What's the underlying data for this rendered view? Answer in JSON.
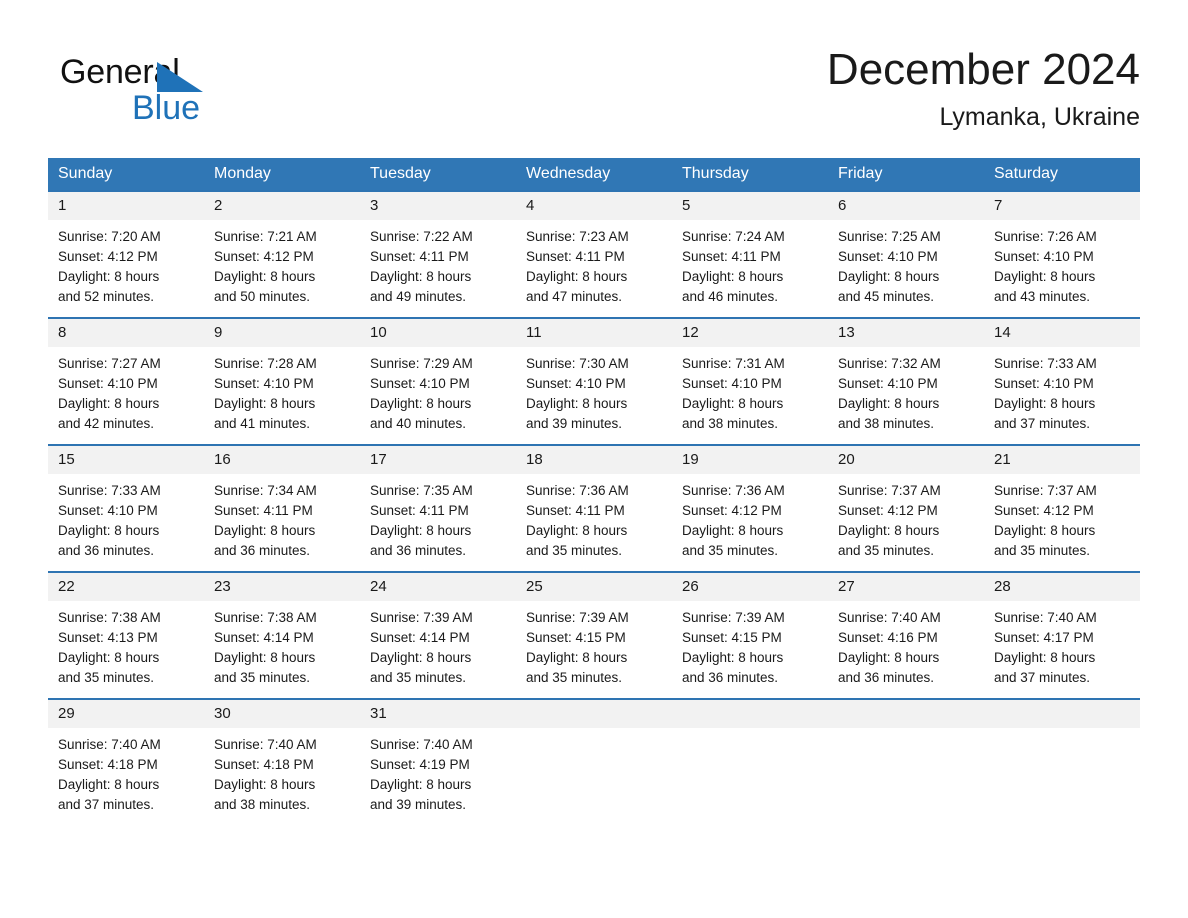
{
  "brand": {
    "line1": "General",
    "line2": "Blue",
    "accent_color": "#1f72b8",
    "triangle_icon": "brand-triangle-icon"
  },
  "header": {
    "month_title": "December 2024",
    "location": "Lymanka, Ukraine"
  },
  "calendar": {
    "header_bg": "#3077b5",
    "row_divider_color": "#2e74b2",
    "daynum_bg": "#f2f2f2",
    "weekdays": [
      "Sunday",
      "Monday",
      "Tuesday",
      "Wednesday",
      "Thursday",
      "Friday",
      "Saturday"
    ],
    "weeks": [
      [
        {
          "day": "1",
          "sunrise": "Sunrise: 7:20 AM",
          "sunset": "Sunset: 4:12 PM",
          "daylight_1": "Daylight: 8 hours",
          "daylight_2": "and 52 minutes."
        },
        {
          "day": "2",
          "sunrise": "Sunrise: 7:21 AM",
          "sunset": "Sunset: 4:12 PM",
          "daylight_1": "Daylight: 8 hours",
          "daylight_2": "and 50 minutes."
        },
        {
          "day": "3",
          "sunrise": "Sunrise: 7:22 AM",
          "sunset": "Sunset: 4:11 PM",
          "daylight_1": "Daylight: 8 hours",
          "daylight_2": "and 49 minutes."
        },
        {
          "day": "4",
          "sunrise": "Sunrise: 7:23 AM",
          "sunset": "Sunset: 4:11 PM",
          "daylight_1": "Daylight: 8 hours",
          "daylight_2": "and 47 minutes."
        },
        {
          "day": "5",
          "sunrise": "Sunrise: 7:24 AM",
          "sunset": "Sunset: 4:11 PM",
          "daylight_1": "Daylight: 8 hours",
          "daylight_2": "and 46 minutes."
        },
        {
          "day": "6",
          "sunrise": "Sunrise: 7:25 AM",
          "sunset": "Sunset: 4:10 PM",
          "daylight_1": "Daylight: 8 hours",
          "daylight_2": "and 45 minutes."
        },
        {
          "day": "7",
          "sunrise": "Sunrise: 7:26 AM",
          "sunset": "Sunset: 4:10 PM",
          "daylight_1": "Daylight: 8 hours",
          "daylight_2": "and 43 minutes."
        }
      ],
      [
        {
          "day": "8",
          "sunrise": "Sunrise: 7:27 AM",
          "sunset": "Sunset: 4:10 PM",
          "daylight_1": "Daylight: 8 hours",
          "daylight_2": "and 42 minutes."
        },
        {
          "day": "9",
          "sunrise": "Sunrise: 7:28 AM",
          "sunset": "Sunset: 4:10 PM",
          "daylight_1": "Daylight: 8 hours",
          "daylight_2": "and 41 minutes."
        },
        {
          "day": "10",
          "sunrise": "Sunrise: 7:29 AM",
          "sunset": "Sunset: 4:10 PM",
          "daylight_1": "Daylight: 8 hours",
          "daylight_2": "and 40 minutes."
        },
        {
          "day": "11",
          "sunrise": "Sunrise: 7:30 AM",
          "sunset": "Sunset: 4:10 PM",
          "daylight_1": "Daylight: 8 hours",
          "daylight_2": "and 39 minutes."
        },
        {
          "day": "12",
          "sunrise": "Sunrise: 7:31 AM",
          "sunset": "Sunset: 4:10 PM",
          "daylight_1": "Daylight: 8 hours",
          "daylight_2": "and 38 minutes."
        },
        {
          "day": "13",
          "sunrise": "Sunrise: 7:32 AM",
          "sunset": "Sunset: 4:10 PM",
          "daylight_1": "Daylight: 8 hours",
          "daylight_2": "and 38 minutes."
        },
        {
          "day": "14",
          "sunrise": "Sunrise: 7:33 AM",
          "sunset": "Sunset: 4:10 PM",
          "daylight_1": "Daylight: 8 hours",
          "daylight_2": "and 37 minutes."
        }
      ],
      [
        {
          "day": "15",
          "sunrise": "Sunrise: 7:33 AM",
          "sunset": "Sunset: 4:10 PM",
          "daylight_1": "Daylight: 8 hours",
          "daylight_2": "and 36 minutes."
        },
        {
          "day": "16",
          "sunrise": "Sunrise: 7:34 AM",
          "sunset": "Sunset: 4:11 PM",
          "daylight_1": "Daylight: 8 hours",
          "daylight_2": "and 36 minutes."
        },
        {
          "day": "17",
          "sunrise": "Sunrise: 7:35 AM",
          "sunset": "Sunset: 4:11 PM",
          "daylight_1": "Daylight: 8 hours",
          "daylight_2": "and 36 minutes."
        },
        {
          "day": "18",
          "sunrise": "Sunrise: 7:36 AM",
          "sunset": "Sunset: 4:11 PM",
          "daylight_1": "Daylight: 8 hours",
          "daylight_2": "and 35 minutes."
        },
        {
          "day": "19",
          "sunrise": "Sunrise: 7:36 AM",
          "sunset": "Sunset: 4:12 PM",
          "daylight_1": "Daylight: 8 hours",
          "daylight_2": "and 35 minutes."
        },
        {
          "day": "20",
          "sunrise": "Sunrise: 7:37 AM",
          "sunset": "Sunset: 4:12 PM",
          "daylight_1": "Daylight: 8 hours",
          "daylight_2": "and 35 minutes."
        },
        {
          "day": "21",
          "sunrise": "Sunrise: 7:37 AM",
          "sunset": "Sunset: 4:12 PM",
          "daylight_1": "Daylight: 8 hours",
          "daylight_2": "and 35 minutes."
        }
      ],
      [
        {
          "day": "22",
          "sunrise": "Sunrise: 7:38 AM",
          "sunset": "Sunset: 4:13 PM",
          "daylight_1": "Daylight: 8 hours",
          "daylight_2": "and 35 minutes."
        },
        {
          "day": "23",
          "sunrise": "Sunrise: 7:38 AM",
          "sunset": "Sunset: 4:14 PM",
          "daylight_1": "Daylight: 8 hours",
          "daylight_2": "and 35 minutes."
        },
        {
          "day": "24",
          "sunrise": "Sunrise: 7:39 AM",
          "sunset": "Sunset: 4:14 PM",
          "daylight_1": "Daylight: 8 hours",
          "daylight_2": "and 35 minutes."
        },
        {
          "day": "25",
          "sunrise": "Sunrise: 7:39 AM",
          "sunset": "Sunset: 4:15 PM",
          "daylight_1": "Daylight: 8 hours",
          "daylight_2": "and 35 minutes."
        },
        {
          "day": "26",
          "sunrise": "Sunrise: 7:39 AM",
          "sunset": "Sunset: 4:15 PM",
          "daylight_1": "Daylight: 8 hours",
          "daylight_2": "and 36 minutes."
        },
        {
          "day": "27",
          "sunrise": "Sunrise: 7:40 AM",
          "sunset": "Sunset: 4:16 PM",
          "daylight_1": "Daylight: 8 hours",
          "daylight_2": "and 36 minutes."
        },
        {
          "day": "28",
          "sunrise": "Sunrise: 7:40 AM",
          "sunset": "Sunset: 4:17 PM",
          "daylight_1": "Daylight: 8 hours",
          "daylight_2": "and 37 minutes."
        }
      ],
      [
        {
          "day": "29",
          "sunrise": "Sunrise: 7:40 AM",
          "sunset": "Sunset: 4:18 PM",
          "daylight_1": "Daylight: 8 hours",
          "daylight_2": "and 37 minutes."
        },
        {
          "day": "30",
          "sunrise": "Sunrise: 7:40 AM",
          "sunset": "Sunset: 4:18 PM",
          "daylight_1": "Daylight: 8 hours",
          "daylight_2": "and 38 minutes."
        },
        {
          "day": "31",
          "sunrise": "Sunrise: 7:40 AM",
          "sunset": "Sunset: 4:19 PM",
          "daylight_1": "Daylight: 8 hours",
          "daylight_2": "and 39 minutes."
        },
        {
          "day": "",
          "sunrise": "",
          "sunset": "",
          "daylight_1": "",
          "daylight_2": ""
        },
        {
          "day": "",
          "sunrise": "",
          "sunset": "",
          "daylight_1": "",
          "daylight_2": ""
        },
        {
          "day": "",
          "sunrise": "",
          "sunset": "",
          "daylight_1": "",
          "daylight_2": ""
        },
        {
          "day": "",
          "sunrise": "",
          "sunset": "",
          "daylight_1": "",
          "daylight_2": ""
        }
      ]
    ]
  }
}
